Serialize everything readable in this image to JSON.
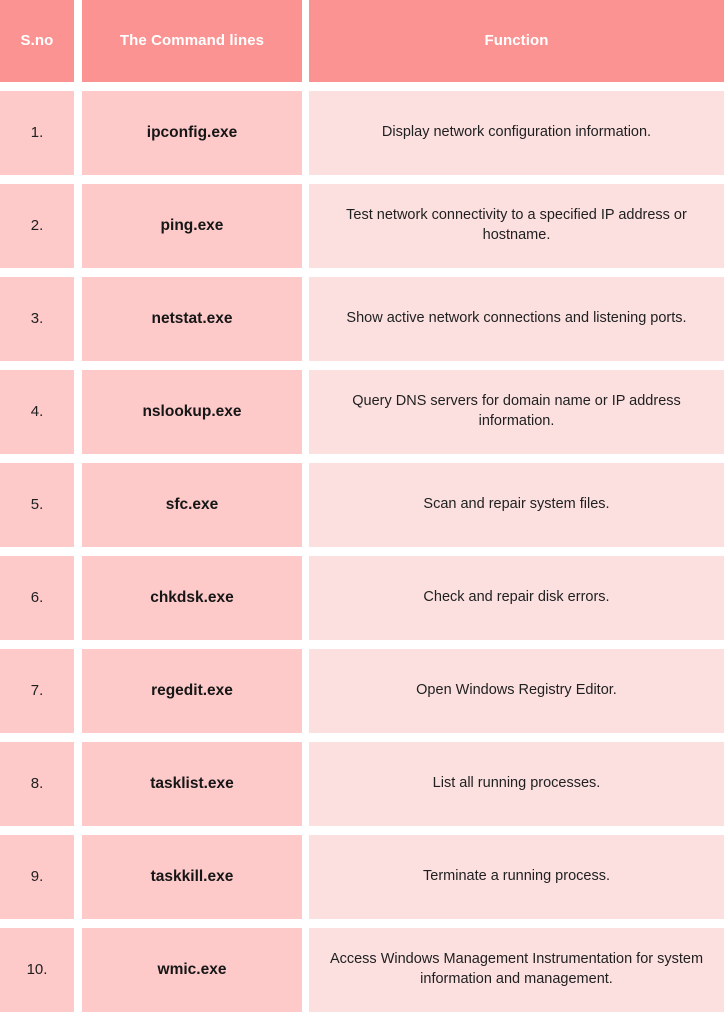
{
  "table": {
    "columns": [
      {
        "key": "sno",
        "label": "S.no"
      },
      {
        "key": "command",
        "label": "The Command lines"
      },
      {
        "key": "function",
        "label": "Function"
      }
    ],
    "header_background": "#fc9393",
    "header_text_color": "#ffffff",
    "cell_background_primary": "#fdc9c9",
    "cell_background_secondary": "#fce0e0",
    "body_text_color": "#1f1f1f",
    "rows": [
      {
        "sno": "1.",
        "command": "ipconfig.exe",
        "function": "Display network configuration information."
      },
      {
        "sno": "2.",
        "command": "ping.exe",
        "function": "Test network connectivity to a specified IP address or hostname."
      },
      {
        "sno": "3.",
        "command": "netstat.exe",
        "function": "Show active network connections and listening ports."
      },
      {
        "sno": "4.",
        "command": "nslookup.exe",
        "function": "Query DNS servers for domain name or IP address information."
      },
      {
        "sno": "5.",
        "command": "sfc.exe",
        "function": "Scan and repair system files."
      },
      {
        "sno": "6.",
        "command": "chkdsk.exe",
        "function": "Check and repair disk errors."
      },
      {
        "sno": "7.",
        "command": "regedit.exe",
        "function": "Open Windows Registry Editor."
      },
      {
        "sno": "8.",
        "command": "tasklist.exe",
        "function": "List all running processes."
      },
      {
        "sno": "9.",
        "command": "taskkill.exe",
        "function": "Terminate a running process."
      },
      {
        "sno": "10.",
        "command": "wmic.exe",
        "function": "Access Windows Management Instrumentation for system information and management."
      }
    ]
  }
}
